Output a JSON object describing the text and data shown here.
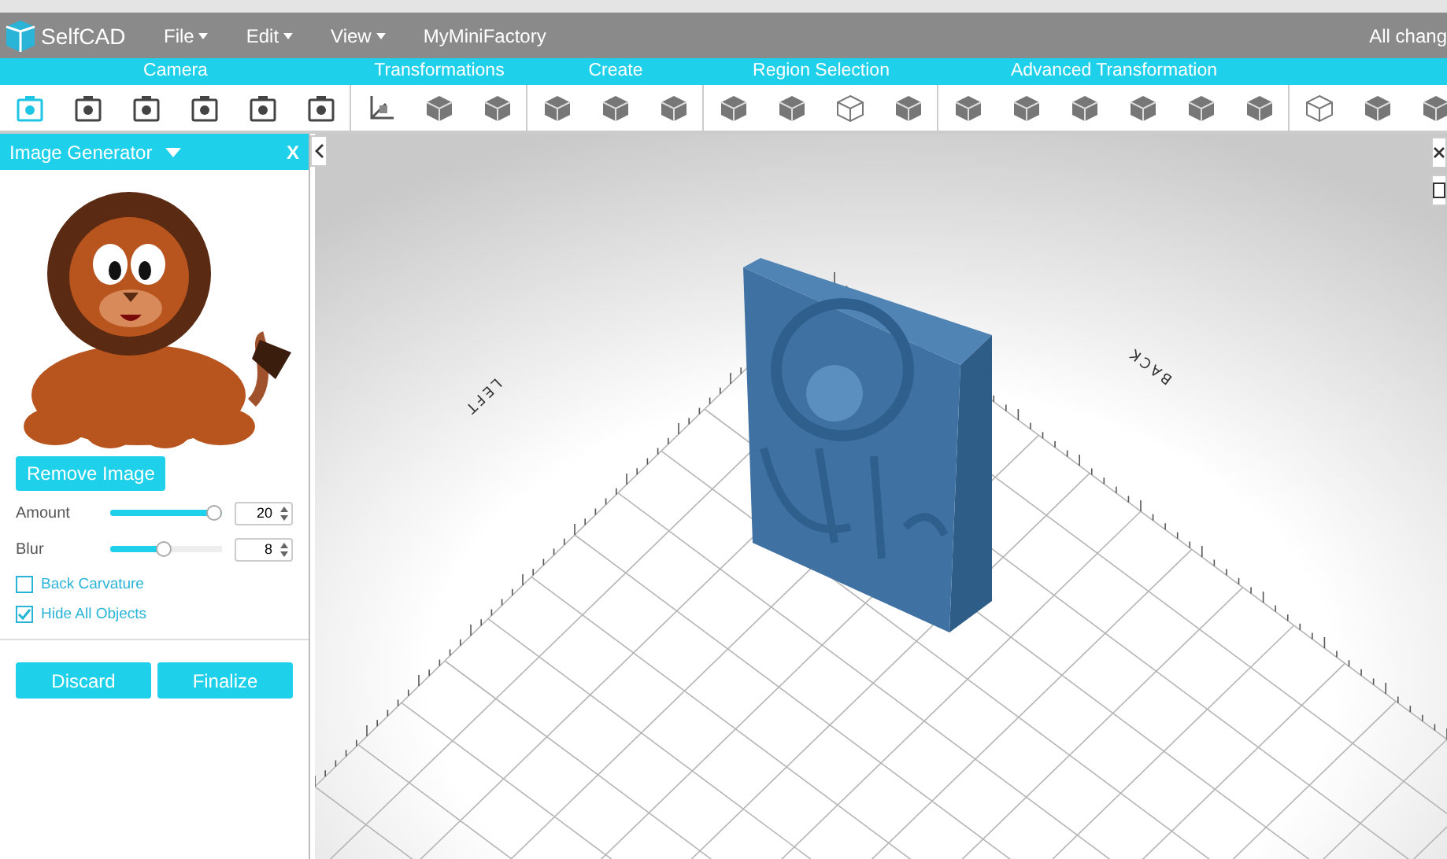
{
  "menu_bar": {
    "logo": "SelfCAD",
    "menus": [
      {
        "label": "File",
        "dropdown": true
      },
      {
        "label": "Edit",
        "dropdown": true
      },
      {
        "label": "View",
        "dropdown": true
      },
      {
        "label": "MyMiniFactory",
        "dropdown": false
      }
    ],
    "status": "All chang"
  },
  "toolbar": [
    {
      "title": "Camera",
      "tools": [
        {
          "kind": "camera",
          "selected": true
        },
        {
          "kind": "camera",
          "selected": false
        },
        {
          "kind": "camera",
          "selected": false
        },
        {
          "kind": "camera",
          "selected": false
        },
        {
          "kind": "camera",
          "selected": false
        },
        {
          "kind": "camera",
          "selected": false
        }
      ]
    },
    {
      "title": "Transformations",
      "tools": [
        {
          "kind": "axes",
          "selected": false
        },
        {
          "kind": "solid",
          "selected": false
        },
        {
          "kind": "solid",
          "selected": false
        }
      ]
    },
    {
      "title": "Create",
      "tools": [
        {
          "kind": "solid",
          "selected": false
        },
        {
          "kind": "solid",
          "selected": false
        },
        {
          "kind": "solid",
          "selected": false
        }
      ]
    },
    {
      "title": "Region Selection",
      "tools": [
        {
          "kind": "solid",
          "selected": false
        },
        {
          "kind": "solid",
          "selected": false
        },
        {
          "kind": "wire",
          "selected": false
        },
        {
          "kind": "solid",
          "selected": false
        }
      ]
    },
    {
      "title": "Advanced Transformation",
      "tools": [
        {
          "kind": "solid",
          "selected": false
        },
        {
          "kind": "solid",
          "selected": false
        },
        {
          "kind": "solid",
          "selected": false
        },
        {
          "kind": "solid",
          "selected": false
        },
        {
          "kind": "solid",
          "selected": false
        },
        {
          "kind": "solid",
          "selected": false
        }
      ]
    },
    {
      "tools": [
        {
          "kind": "wire",
          "selected": false
        },
        {
          "kind": "solid",
          "selected": false
        },
        {
          "kind": "solid",
          "selected": false
        }
      ]
    }
  ],
  "panel": {
    "title": "Image Generator",
    "close": "X",
    "remove_button": "Remove Image",
    "sliders": [
      {
        "label": "Amount",
        "level": 1.0,
        "value": "20"
      },
      {
        "label": "Blur",
        "level": 0.48,
        "value": "8"
      }
    ],
    "checkboxes": [
      {
        "label": "Back Carvature",
        "checked": false
      },
      {
        "label": "Hide All Objects",
        "checked": true
      }
    ],
    "buttons": [
      "Discard",
      "Finalize"
    ]
  },
  "viewport": {
    "axis_labels": [
      {
        "kind": "left",
        "text": "LEFT"
      },
      {
        "kind": "back",
        "text": "BACK"
      }
    ]
  }
}
